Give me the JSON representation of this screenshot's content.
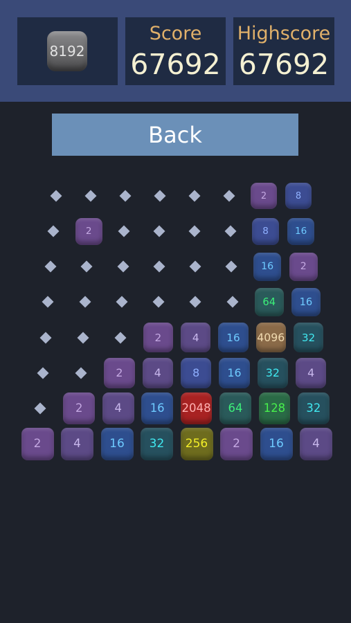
{
  "header": {
    "best_tile": "8192",
    "score_label": "Score",
    "score_value": "67692",
    "highscore_label": "Highscore",
    "highscore_value": "67692"
  },
  "back_button_label": "Back",
  "tile_colors": {
    "2": {
      "bg": "#6a4a8c",
      "fg": "#c4a8e2"
    },
    "4": {
      "bg": "#5c4a86",
      "fg": "#c8b8ec"
    },
    "8": {
      "bg": "#3c4c92",
      "fg": "#8fb0ff"
    },
    "16": {
      "bg": "#2e4e8e",
      "fg": "#6ecaff"
    },
    "32": {
      "bg": "#26505e",
      "fg": "#40e8f0"
    },
    "64": {
      "bg": "#2a5a5a",
      "fg": "#3cf07a"
    },
    "128": {
      "bg": "#2a6a46",
      "fg": "#48f04c"
    },
    "256": {
      "bg": "#6e6c1e",
      "fg": "#f2ee28"
    },
    "2048": {
      "bg": "#a82222",
      "fg": "#ffb0b0"
    },
    "4096": {
      "bg": "#8a6a48",
      "fg": "#f0dab0"
    }
  },
  "board": {
    "rows": [
      [
        "",
        "",
        "",
        "",
        "",
        "",
        "2",
        "8"
      ],
      [
        "",
        "2",
        "",
        "",
        "",
        "",
        "8",
        "16"
      ],
      [
        "",
        "",
        "",
        "",
        "",
        "",
        "16",
        "2"
      ],
      [
        "",
        "",
        "",
        "",
        "",
        "",
        "64",
        "16"
      ],
      [
        "",
        "",
        "",
        "2",
        "4",
        "16",
        "4096",
        "32"
      ],
      [
        "",
        "",
        "2",
        "4",
        "8",
        "16",
        "32",
        "4"
      ],
      [
        "",
        "2",
        "4",
        "16",
        "2048",
        "64",
        "128",
        "32"
      ],
      [
        "2",
        "4",
        "16",
        "32",
        "256",
        "2",
        "16",
        "4"
      ]
    ]
  }
}
